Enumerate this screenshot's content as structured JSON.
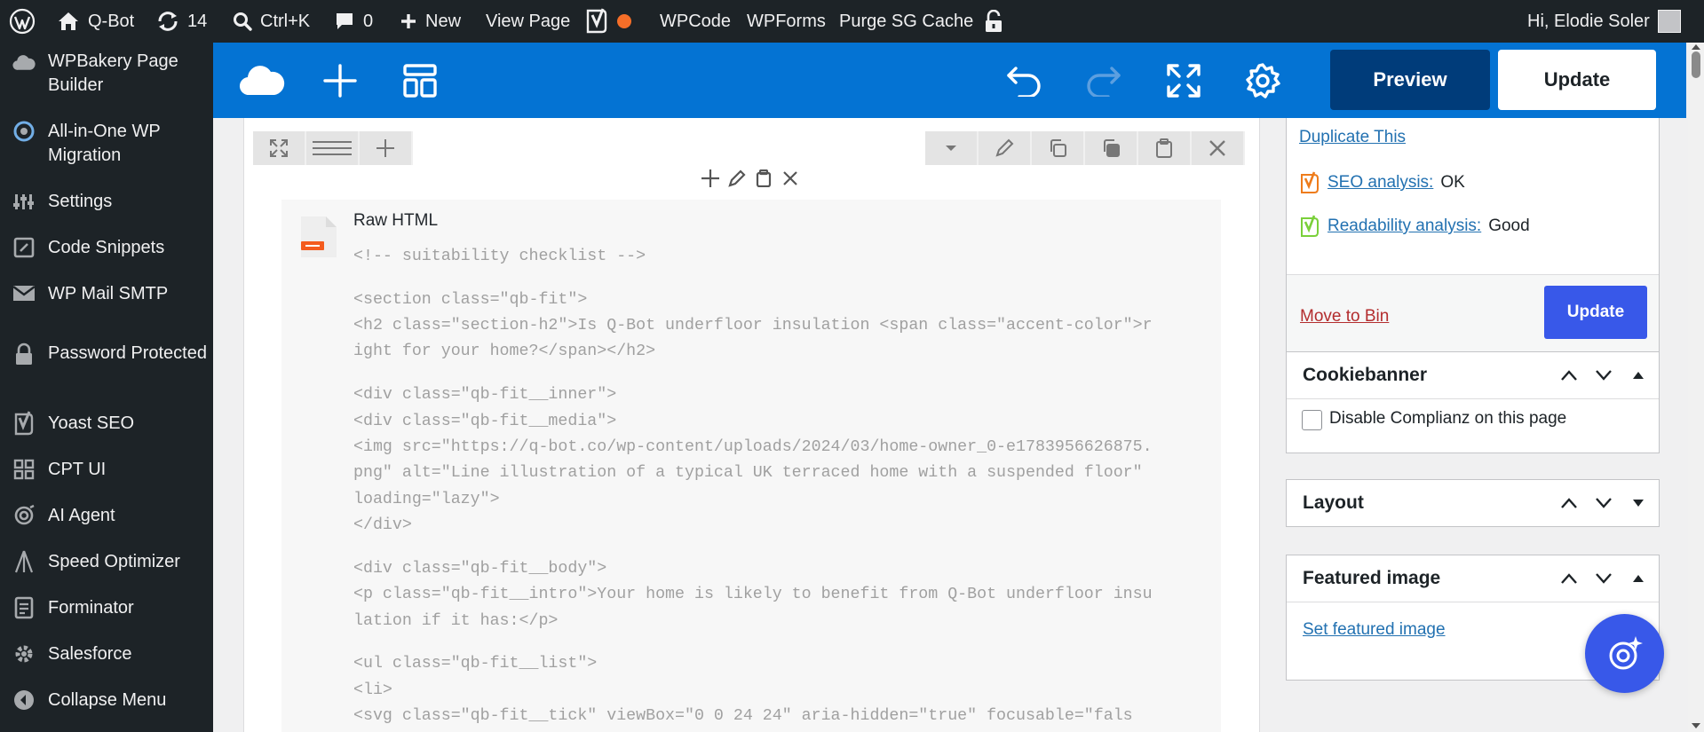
{
  "admin_bar": {
    "site_name": "Q-Bot",
    "updates_count": "14",
    "search_shortcut": "Ctrl+K",
    "comments_count": "0",
    "new_label": "New",
    "view_page": "View Page",
    "wpcode": "WPCode",
    "wpforms": "WPForms",
    "purge_cache": "Purge SG Cache",
    "greeting": "Hi, Elodie Soler"
  },
  "sidebar": {
    "items": [
      {
        "label": "WPBakery Page Builder",
        "icon": "wpbakery-cloud-icon"
      },
      {
        "label": "All-in-One WP Migration",
        "icon": "migration-icon"
      },
      {
        "label": "Settings",
        "icon": "settings-icon"
      },
      {
        "label": "Code Snippets",
        "icon": "code-snippets-icon"
      },
      {
        "label": "WP Mail SMTP",
        "icon": "mail-icon"
      },
      {
        "label": "Password Protected",
        "icon": "lock-icon"
      },
      {
        "label": "Yoast SEO",
        "icon": "yoast-icon"
      },
      {
        "label": "CPT UI",
        "icon": "cpt-ui-icon"
      },
      {
        "label": "AI Agent",
        "icon": "ai-agent-icon"
      },
      {
        "label": "Speed Optimizer",
        "icon": "speed-optimizer-icon"
      },
      {
        "label": "Forminator",
        "icon": "forminator-icon"
      },
      {
        "label": "Salesforce",
        "icon": "salesforce-gear-icon"
      },
      {
        "label": "Collapse Menu",
        "icon": "collapse-icon"
      }
    ]
  },
  "toolbar": {
    "preview_label": "Preview",
    "update_label": "Update"
  },
  "editor": {
    "element_title": "Raw HTML",
    "code_lines": [
      "<!-- suitability checklist -->",
      "",
      "<section class=\"qb-fit\">",
      "<h2 class=\"section-h2\">Is Q-Bot underfloor insulation <span class=\"accent-color\">r",
      "ight for your home?</span></h2>",
      "",
      "<div class=\"qb-fit__inner\">",
      "<div class=\"qb-fit__media\">",
      "<img src=\"https://q-bot.co/wp-content/uploads/2024/03/home-owner_0-e1783956626875.",
      "png\" alt=\"Line illustration of a typical UK terraced home with a suspended floor\"",
      "loading=\"lazy\">",
      "</div>",
      "",
      "<div class=\"qb-fit__body\">",
      "<p class=\"qb-fit__intro\">Your home is likely to benefit from Q-Bot underfloor insu",
      "lation if it has:</p>",
      "",
      "<ul class=\"qb-fit__list\">",
      "<li>",
      "<svg class=\"qb-fit__tick\" viewBox=\"0 0 24 24\" aria-hidden=\"true\" focusable=\"fals"
    ]
  },
  "publish": {
    "duplicate": "Duplicate This",
    "seo_label": "SEO analysis:",
    "seo_value": "OK",
    "readability_label": "Readability analysis:",
    "readability_value": "Good",
    "move_to_bin": "Move to Bin",
    "update_label": "Update",
    "seo_color": "#ee7c1b",
    "readability_color": "#7ad03a"
  },
  "cookiebanner": {
    "title": "Cookiebanner",
    "checkbox_label": "Disable Complianz on this page",
    "checked": false
  },
  "layout_box": {
    "title": "Layout"
  },
  "featured_image": {
    "title": "Featured image",
    "link": "Set featured image"
  },
  "colors": {
    "admin_bar": "#1d2327",
    "builder_blue": "#0473d3",
    "preview_dark": "#003c7a",
    "primary_button": "#3858e9"
  }
}
